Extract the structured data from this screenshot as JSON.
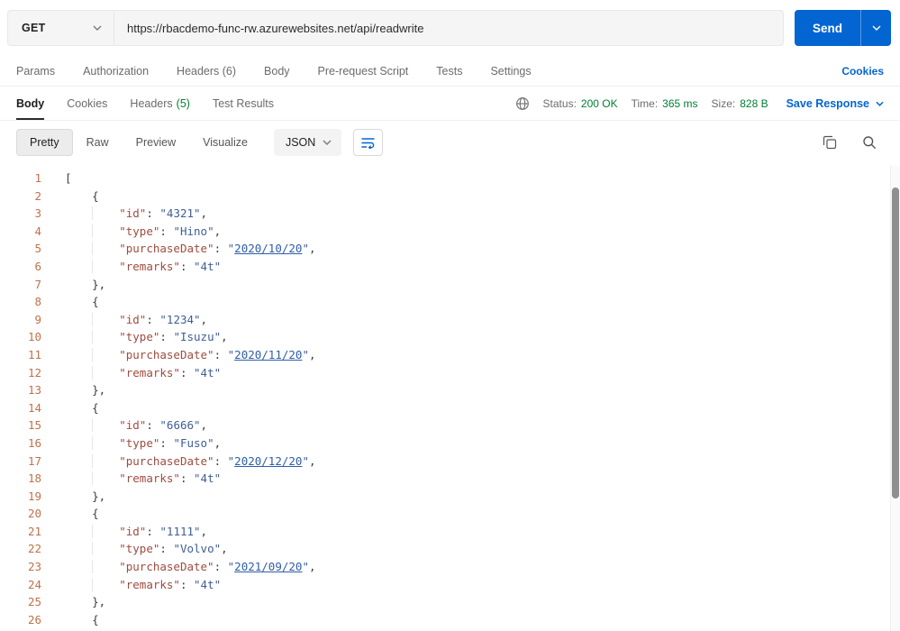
{
  "colors": {
    "accent": "#0265d2",
    "success": "#007f31",
    "json-key": "#9e4c3f",
    "json-string": "#3f5e96",
    "json-link": "#2f5da9",
    "line-number": "#c0714a"
  },
  "request": {
    "method": "GET",
    "url": "https://rbacdemo-func-rw.azurewebsites.net/api/readwrite",
    "send_label": "Send",
    "cookies_link": "Cookies",
    "tabs": [
      "Params",
      "Authorization",
      "Headers (6)",
      "Body",
      "Pre-request Script",
      "Tests",
      "Settings"
    ]
  },
  "response": {
    "tabs": {
      "body": "Body",
      "cookies": "Cookies",
      "headers": "Headers",
      "headers_count": "(5)",
      "test_results": "Test Results"
    },
    "meta": {
      "status_label": "Status:",
      "status_value": "200 OK",
      "time_label": "Time:",
      "time_value": "365 ms",
      "size_label": "Size:",
      "size_value": "828 B",
      "save_label": "Save Response"
    },
    "view": {
      "pretty": "Pretty",
      "raw": "Raw",
      "preview": "Preview",
      "visualize": "Visualize",
      "format": "JSON"
    }
  },
  "code": {
    "lines": [
      {
        "n": 1,
        "t": [
          [
            "p",
            "["
          ]
        ]
      },
      {
        "n": 2,
        "t": [
          [
            "i",
            "    "
          ],
          [
            "p",
            "{"
          ]
        ]
      },
      {
        "n": 3,
        "t": [
          [
            "g",
            "        "
          ],
          [
            "k",
            "\"id\""
          ],
          [
            "p",
            ": "
          ],
          [
            "s",
            "\"4321\""
          ],
          [
            "p",
            ","
          ]
        ]
      },
      {
        "n": 4,
        "t": [
          [
            "g",
            "        "
          ],
          [
            "k",
            "\"type\""
          ],
          [
            "p",
            ": "
          ],
          [
            "s",
            "\"Hino\""
          ],
          [
            "p",
            ","
          ]
        ]
      },
      {
        "n": 5,
        "t": [
          [
            "g",
            "        "
          ],
          [
            "k",
            "\"purchaseDate\""
          ],
          [
            "p",
            ": "
          ],
          [
            "s",
            "\""
          ],
          [
            "l",
            "2020/10/20"
          ],
          [
            "s",
            "\""
          ],
          [
            "p",
            ","
          ]
        ]
      },
      {
        "n": 6,
        "t": [
          [
            "g",
            "        "
          ],
          [
            "k",
            "\"remarks\""
          ],
          [
            "p",
            ": "
          ],
          [
            "s",
            "\"4t\""
          ]
        ]
      },
      {
        "n": 7,
        "t": [
          [
            "i",
            "    "
          ],
          [
            "p",
            "},"
          ]
        ]
      },
      {
        "n": 8,
        "t": [
          [
            "i",
            "    "
          ],
          [
            "p",
            "{"
          ]
        ]
      },
      {
        "n": 9,
        "t": [
          [
            "g",
            "        "
          ],
          [
            "k",
            "\"id\""
          ],
          [
            "p",
            ": "
          ],
          [
            "s",
            "\"1234\""
          ],
          [
            "p",
            ","
          ]
        ]
      },
      {
        "n": 10,
        "t": [
          [
            "g",
            "        "
          ],
          [
            "k",
            "\"type\""
          ],
          [
            "p",
            ": "
          ],
          [
            "s",
            "\"Isuzu\""
          ],
          [
            "p",
            ","
          ]
        ]
      },
      {
        "n": 11,
        "t": [
          [
            "g",
            "        "
          ],
          [
            "k",
            "\"purchaseDate\""
          ],
          [
            "p",
            ": "
          ],
          [
            "s",
            "\""
          ],
          [
            "l",
            "2020/11/20"
          ],
          [
            "s",
            "\""
          ],
          [
            "p",
            ","
          ]
        ]
      },
      {
        "n": 12,
        "t": [
          [
            "g",
            "        "
          ],
          [
            "k",
            "\"remarks\""
          ],
          [
            "p",
            ": "
          ],
          [
            "s",
            "\"4t\""
          ]
        ]
      },
      {
        "n": 13,
        "t": [
          [
            "i",
            "    "
          ],
          [
            "p",
            "},"
          ]
        ]
      },
      {
        "n": 14,
        "t": [
          [
            "i",
            "    "
          ],
          [
            "p",
            "{"
          ]
        ]
      },
      {
        "n": 15,
        "t": [
          [
            "g",
            "        "
          ],
          [
            "k",
            "\"id\""
          ],
          [
            "p",
            ": "
          ],
          [
            "s",
            "\"6666\""
          ],
          [
            "p",
            ","
          ]
        ]
      },
      {
        "n": 16,
        "t": [
          [
            "g",
            "        "
          ],
          [
            "k",
            "\"type\""
          ],
          [
            "p",
            ": "
          ],
          [
            "s",
            "\"Fuso\""
          ],
          [
            "p",
            ","
          ]
        ]
      },
      {
        "n": 17,
        "t": [
          [
            "g",
            "        "
          ],
          [
            "k",
            "\"purchaseDate\""
          ],
          [
            "p",
            ": "
          ],
          [
            "s",
            "\""
          ],
          [
            "l",
            "2020/12/20"
          ],
          [
            "s",
            "\""
          ],
          [
            "p",
            ","
          ]
        ]
      },
      {
        "n": 18,
        "t": [
          [
            "g",
            "        "
          ],
          [
            "k",
            "\"remarks\""
          ],
          [
            "p",
            ": "
          ],
          [
            "s",
            "\"4t\""
          ]
        ]
      },
      {
        "n": 19,
        "t": [
          [
            "i",
            "    "
          ],
          [
            "p",
            "},"
          ]
        ]
      },
      {
        "n": 20,
        "t": [
          [
            "i",
            "    "
          ],
          [
            "p",
            "{"
          ]
        ]
      },
      {
        "n": 21,
        "t": [
          [
            "g",
            "        "
          ],
          [
            "k",
            "\"id\""
          ],
          [
            "p",
            ": "
          ],
          [
            "s",
            "\"1111\""
          ],
          [
            "p",
            ","
          ]
        ]
      },
      {
        "n": 22,
        "t": [
          [
            "g",
            "        "
          ],
          [
            "k",
            "\"type\""
          ],
          [
            "p",
            ": "
          ],
          [
            "s",
            "\"Volvo\""
          ],
          [
            "p",
            ","
          ]
        ]
      },
      {
        "n": 23,
        "t": [
          [
            "g",
            "        "
          ],
          [
            "k",
            "\"purchaseDate\""
          ],
          [
            "p",
            ": "
          ],
          [
            "s",
            "\""
          ],
          [
            "l",
            "2021/09/20"
          ],
          [
            "s",
            "\""
          ],
          [
            "p",
            ","
          ]
        ]
      },
      {
        "n": 24,
        "t": [
          [
            "g",
            "        "
          ],
          [
            "k",
            "\"remarks\""
          ],
          [
            "p",
            ": "
          ],
          [
            "s",
            "\"4t\""
          ]
        ]
      },
      {
        "n": 25,
        "t": [
          [
            "i",
            "    "
          ],
          [
            "p",
            "},"
          ]
        ]
      },
      {
        "n": 26,
        "t": [
          [
            "i",
            "    "
          ],
          [
            "p",
            "{"
          ]
        ]
      }
    ]
  }
}
